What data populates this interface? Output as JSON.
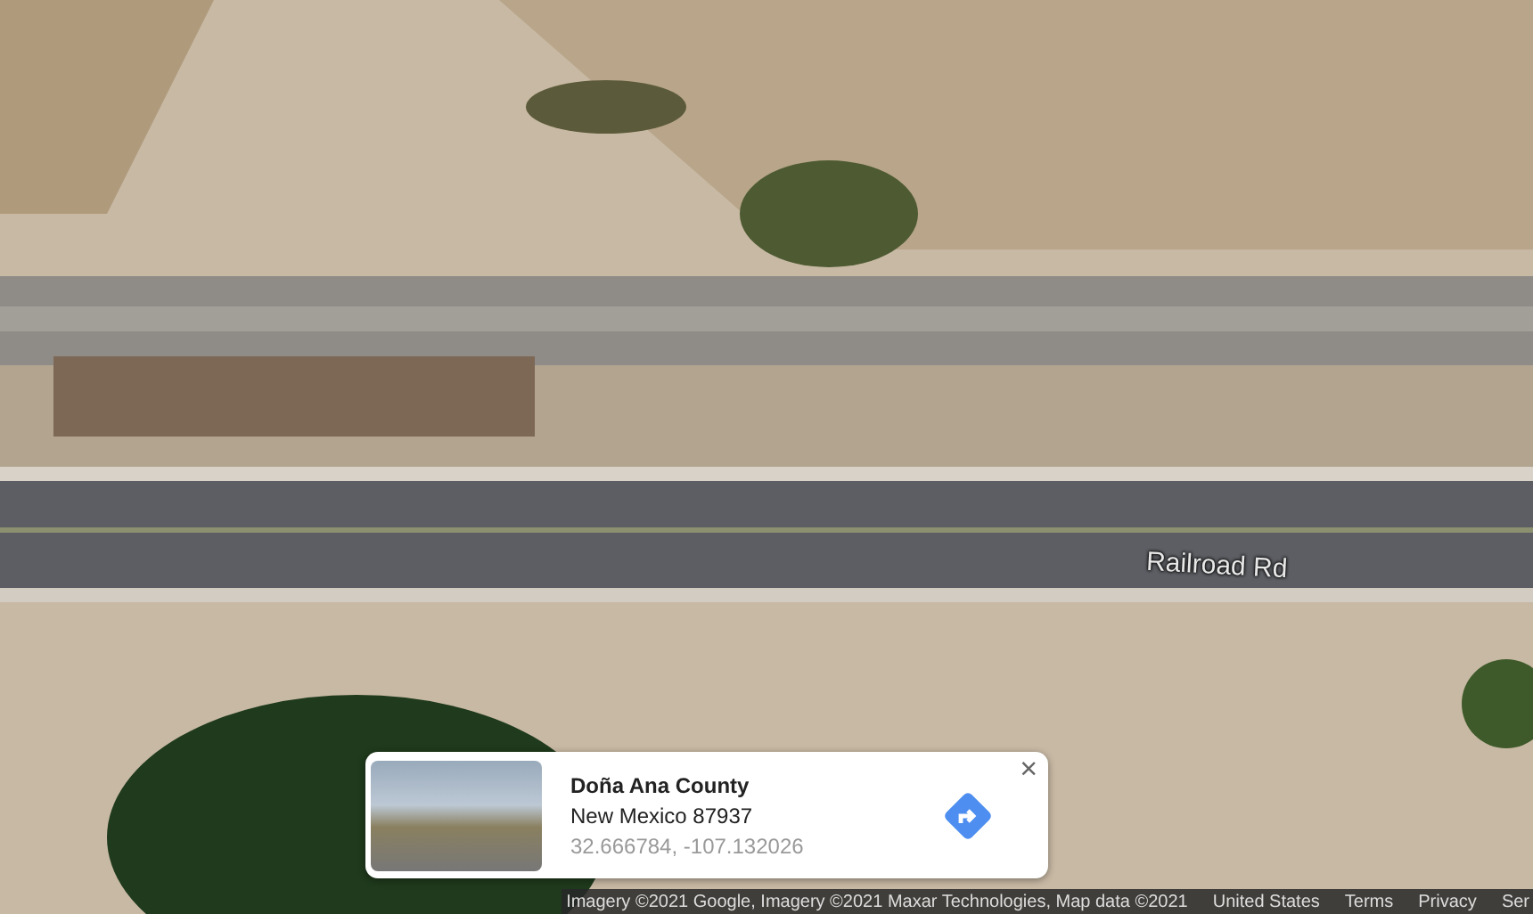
{
  "map": {
    "road_label": "Railroad Rd"
  },
  "place_card": {
    "title": "Doña Ana County",
    "address": "New Mexico 87937",
    "coordinates": "32.666784, -107.132026",
    "close": "×"
  },
  "footer": {
    "attribution": "Imagery ©2021 Google, Imagery ©2021 Maxar Technologies, Map data ©2021",
    "links": [
      "United States",
      "Terms",
      "Privacy",
      "Ser"
    ]
  }
}
